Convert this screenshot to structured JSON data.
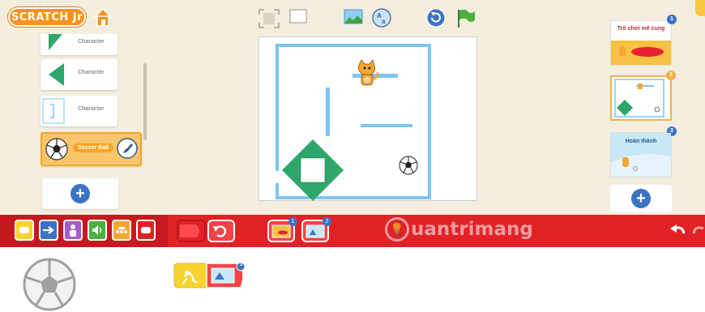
{
  "app": {
    "logo_text": "SCRATCH Jr"
  },
  "sprites": {
    "items": [
      {
        "label": "Character",
        "thumb": "green-triangle"
      },
      {
        "label": "Character",
        "thumb": "green-triangle-left"
      },
      {
        "label": "Character",
        "thumb": "blue-bracket"
      },
      {
        "label": "Soccer Ball",
        "thumb": "soccer-ball",
        "selected": true
      }
    ]
  },
  "toolbar": {
    "icons": [
      "fullscreen-icon",
      "grid-toggle-icon",
      "background-icon",
      "text-icon",
      "reset-icon",
      "green-flag-icon"
    ]
  },
  "pages": {
    "items": [
      {
        "number": "1",
        "label": "Trò chơi mê cung"
      },
      {
        "number": "2",
        "label": ""
      },
      {
        "number": "3",
        "label": "Hoàn thành"
      }
    ]
  },
  "palette": {
    "categories": [
      "trigger-category",
      "motion-category",
      "looks-category",
      "sound-category",
      "control-category",
      "end-category"
    ],
    "blocks": [
      "end-block",
      "repeat-forever-block",
      "go-to-page-1-block",
      "go-to-page-2-block"
    ],
    "page_badges": [
      "1",
      "2"
    ]
  },
  "watermark": {
    "text": "uantrimang"
  },
  "script": {
    "page_badge": "3"
  },
  "colors": {
    "workspace_bg": "#f3eede",
    "palette_red": "#e02227",
    "accent_orange": "#f7931e",
    "maze_blue": "#7ec4f2",
    "diamond_green": "#2fa66a"
  }
}
